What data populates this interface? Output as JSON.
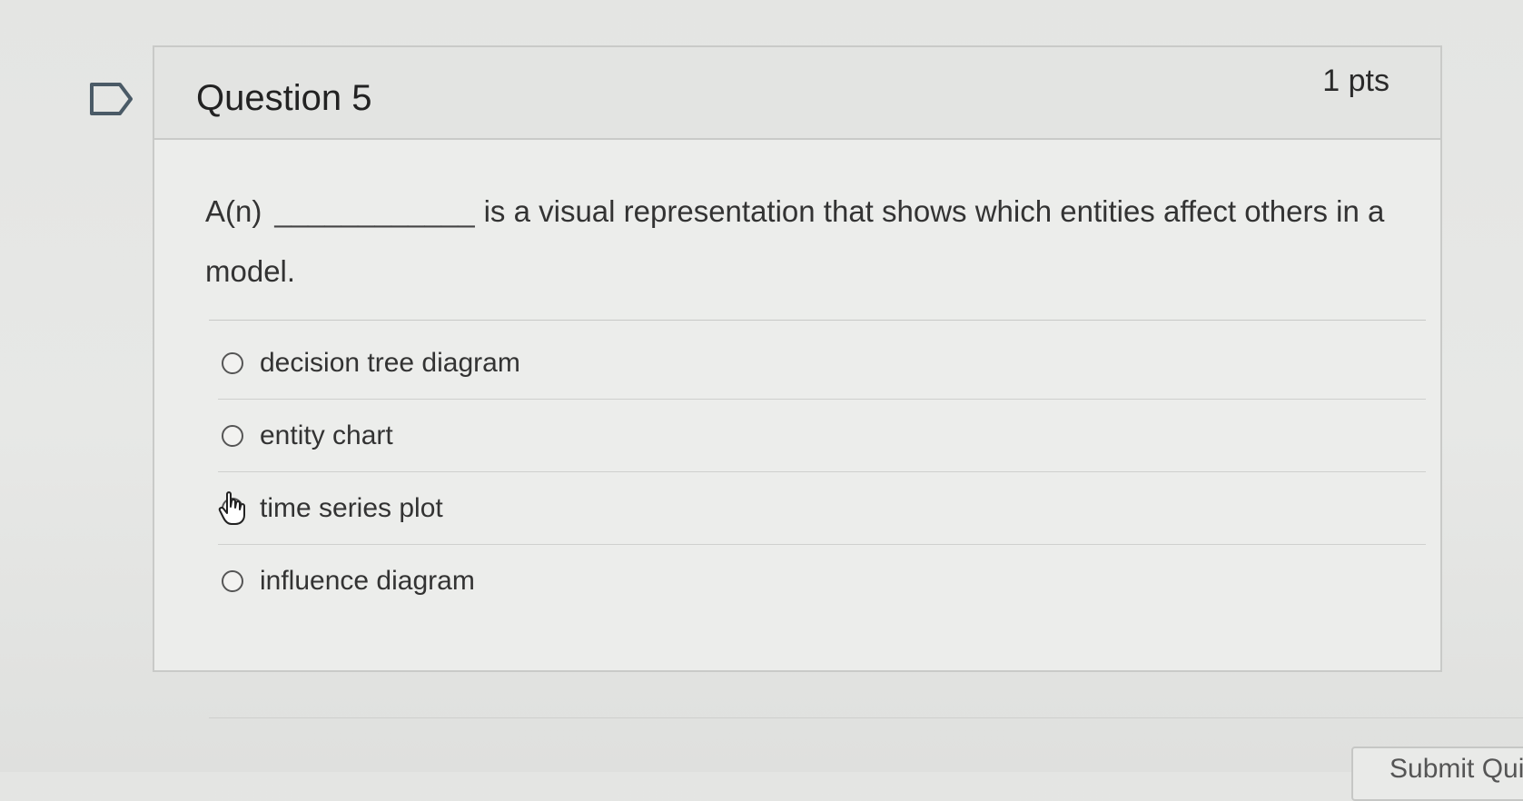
{
  "question": {
    "title": "Question 5",
    "points": "1 pts",
    "text_before": "A(n)",
    "blank": "____________",
    "text_after": "is a visual representation that shows which entities affect others in a model."
  },
  "answers": [
    {
      "label": "decision tree diagram"
    },
    {
      "label": "entity chart"
    },
    {
      "label": "time series plot"
    },
    {
      "label": "influence diagram"
    }
  ],
  "icons": {
    "flag": "flag-icon",
    "cursor": "hand-cursor-icon"
  },
  "footer": {
    "submit_label": "Submit Quiz"
  },
  "colors": {
    "text": "#2d3b45",
    "border": "#c9cac8",
    "background": "#e6e7e5"
  }
}
